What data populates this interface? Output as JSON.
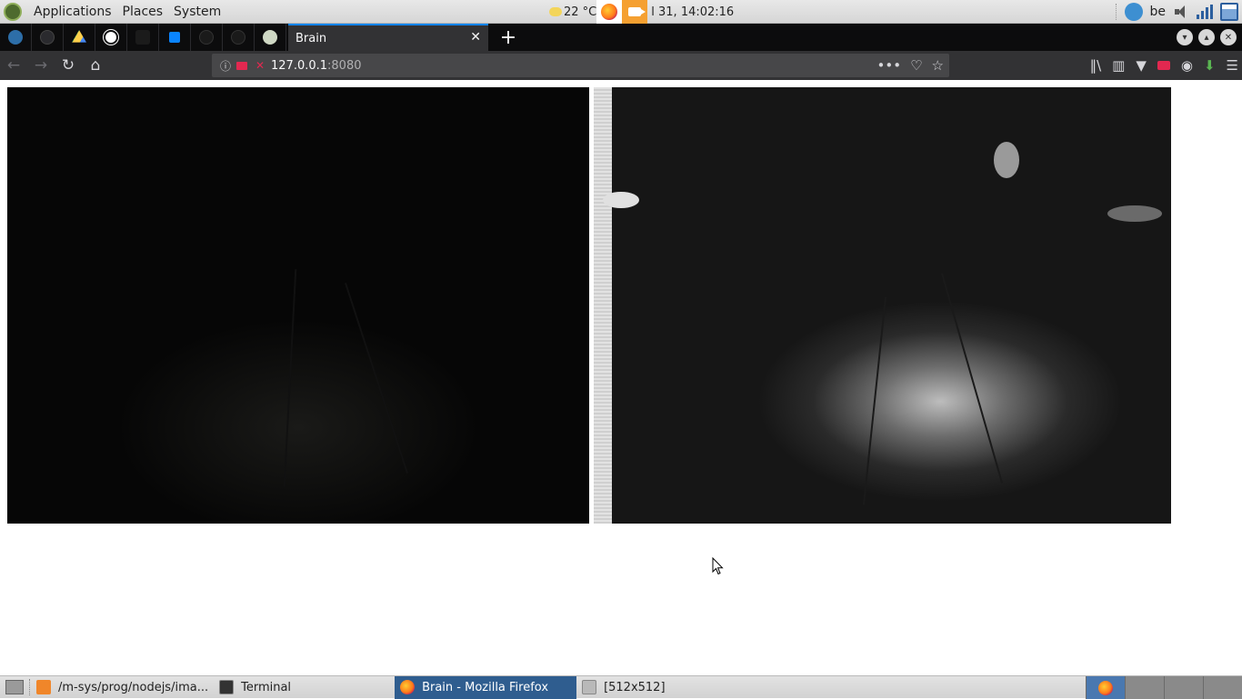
{
  "system_panel": {
    "menus": [
      "Applications",
      "Places",
      "System"
    ],
    "weather": "22 °C",
    "clock": "l 31, 14:02:16",
    "keyboard_layout": "be"
  },
  "browser": {
    "active_tab_title": "Brain",
    "close_symbol": "✕",
    "new_tab_symbol": "+",
    "url_host": "127.0.0.1",
    "url_port": ":8080",
    "pinned_tabs": [
      "edge-icon",
      "greyed-icon",
      "drive-icon",
      "globe-icon",
      "dark-icon",
      "pocket-icon",
      "greyed-icon-2",
      "greyed-icon-3",
      "infinity-icon"
    ]
  },
  "content": {
    "panels": [
      "raw-camera-frame",
      "processed-camera-frame"
    ]
  },
  "taskbar": {
    "items": [
      {
        "label": "/m-sys/prog/nodejs/ima...",
        "icon": "sublime-icon"
      },
      {
        "label": "Terminal",
        "icon": "terminal-icon"
      },
      {
        "label": "Brain - Mozilla Firefox",
        "icon": "firefox-icon",
        "active": true
      },
      {
        "label": "[512x512]",
        "icon": "folder-icon"
      }
    ]
  },
  "colors": {
    "tab_accent": "#0a84ff",
    "taskbar_active": "#2f5d8f",
    "firefox_chrome": "#323234"
  }
}
